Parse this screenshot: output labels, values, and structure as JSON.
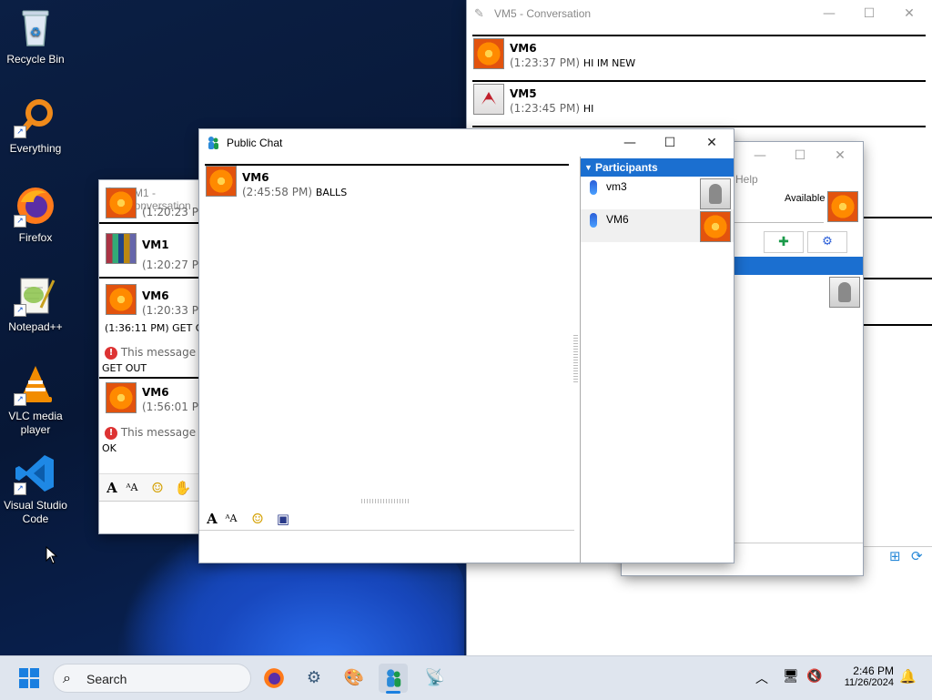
{
  "desktop": {
    "icons": [
      {
        "label": "Recycle Bin",
        "icon": "recycle-bin-icon"
      },
      {
        "label": "Everything",
        "icon": "everything-search-icon"
      },
      {
        "label": "Firefox",
        "icon": "firefox-icon"
      },
      {
        "label": "Notepad++",
        "icon": "notepadpp-icon"
      },
      {
        "label": "VLC media player",
        "icon": "vlc-icon"
      },
      {
        "label": "Visual Studio Code",
        "icon": "vscode-icon"
      }
    ]
  },
  "vm5_window": {
    "title": "VM5 - Conversation",
    "messages": [
      {
        "name": "VM6",
        "time": "(1:23:37 PM)",
        "text": "HI IM NEW",
        "avatar": "flower"
      },
      {
        "name": "VM5",
        "time": "(1:23:45 PM)",
        "text": "HI",
        "avatar": "crane"
      }
    ]
  },
  "contacts_window": {
    "menu_help": "Help",
    "status": "Available"
  },
  "vm1_window": {
    "title": "VM1 - Conversation",
    "rows": [
      {
        "type": "partial",
        "time": "(1:20:23 PM"
      },
      {
        "type": "msg",
        "name": "VM1",
        "time": "(1:20:27 PM",
        "avatar": "bottles"
      },
      {
        "type": "msg",
        "name": "VM6",
        "time": "(1:20:33 PM",
        "avatar": "flower"
      },
      {
        "type": "line",
        "text": "(1:36:11 PM) GET OU"
      },
      {
        "type": "notice",
        "text": "This message",
        "sub": "GET OUT"
      },
      {
        "type": "msg",
        "name": "VM6",
        "time": "(1:56:01 PM",
        "avatar": "flower"
      },
      {
        "type": "notice",
        "text": "This message",
        "sub": "OK"
      }
    ]
  },
  "public_chat": {
    "title": "Public Chat",
    "messages": [
      {
        "name": "VM6",
        "time": "(2:45:58 PM)",
        "text": "BALLS",
        "avatar": "flower"
      }
    ],
    "participants_header": "Participants",
    "participants": [
      {
        "name": "vm3",
        "avatar": "robot"
      },
      {
        "name": "VM6",
        "avatar": "flower"
      }
    ]
  },
  "taskbar": {
    "search_label": "Search",
    "time": "2:46 PM",
    "date": "11/26/2024"
  },
  "colors": {
    "accent": "#1b6fd0",
    "taskbar": "#dfe5ee"
  }
}
